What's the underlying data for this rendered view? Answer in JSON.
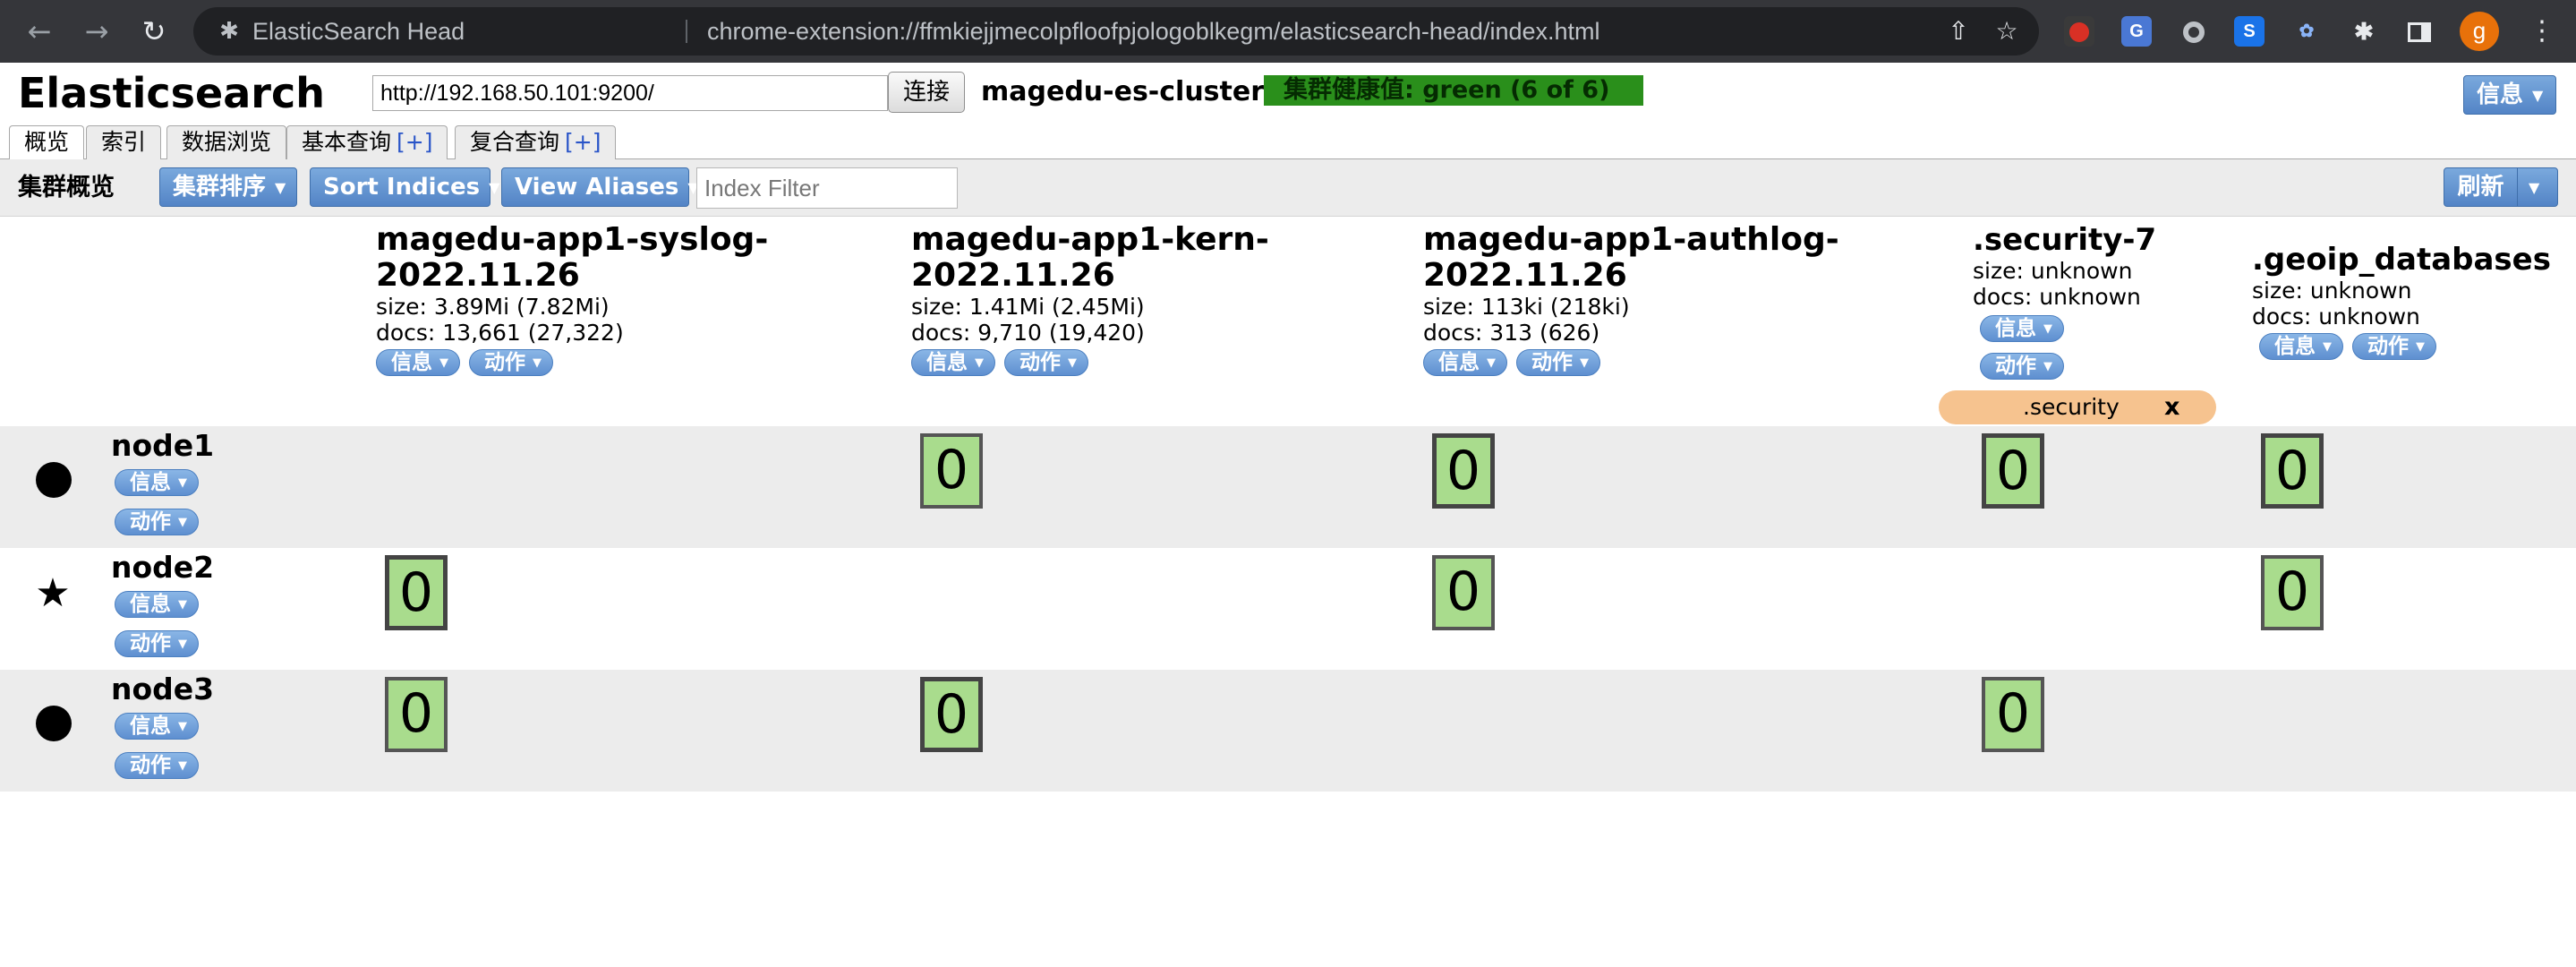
{
  "browser": {
    "site_name": "ElasticSearch Head",
    "url": "chrome-extension://ffmkiejjmecolpfloofpjologoblkegm/elasticsearch-head/index.html",
    "profile_initial": "g"
  },
  "header": {
    "title": "Elasticsearch",
    "connection_url": "http://192.168.50.101:9200/",
    "connect_label": "连接",
    "cluster_name": "magedu-es-cluster",
    "health": "集群健康值: green (6 of 6)",
    "info_label": "信息"
  },
  "tabs": [
    {
      "label": "概览",
      "plus": ""
    },
    {
      "label": "索引",
      "plus": ""
    },
    {
      "label": "数据浏览",
      "plus": ""
    },
    {
      "label": "基本查询",
      "plus": "[+]"
    },
    {
      "label": "复合查询",
      "plus": "[+]"
    }
  ],
  "toolbar": {
    "title": "集群概览",
    "sort_cluster": "集群排序",
    "sort_indices": "Sort Indices",
    "view_aliases": "View Aliases",
    "filter_placeholder": "Index Filter",
    "refresh": "刷新"
  },
  "indices": [
    {
      "name_line1": "magedu-app1-syslog-",
      "name_line2": "2022.11.26",
      "size": "size: 3.89Mi (7.82Mi)",
      "docs": "docs: 13,661 (27,322)",
      "info": "信息",
      "action": "动作"
    },
    {
      "name_line1": "magedu-app1-kern-",
      "name_line2": "2022.11.26",
      "size": "size: 1.41Mi (2.45Mi)",
      "docs": "docs: 9,710 (19,420)",
      "info": "信息",
      "action": "动作"
    },
    {
      "name_line1": "magedu-app1-authlog-",
      "name_line2": "2022.11.26",
      "size": "size: 113ki (218ki)",
      "docs": "docs: 313 (626)",
      "info": "信息",
      "action": "动作"
    },
    {
      "name_line1": ".security-7",
      "size": "size: unknown",
      "docs": "docs: unknown",
      "info": "信息",
      "action": "动作",
      "alias": ".security",
      "alias_close": "x"
    },
    {
      "name_line1": ".geoip_databases",
      "size": "size: unknown",
      "docs": "docs: unknown",
      "info": "信息",
      "action": "动作"
    }
  ],
  "nodes": [
    {
      "name": "node1",
      "marker": "circle-icon",
      "info": "信息",
      "action": "动作"
    },
    {
      "name": "node2",
      "marker": "star-icon",
      "info": "信息",
      "action": "动作"
    },
    {
      "name": "node3",
      "marker": "circle-icon",
      "info": "信息",
      "action": "动作"
    }
  ],
  "shards": {
    "node1": [
      "0",
      "0",
      "0",
      "0"
    ],
    "node2": [
      "0",
      "0",
      "0"
    ],
    "node3": [
      "0",
      "0",
      "0"
    ]
  },
  "colors": {
    "health_green": "#2a8f1b",
    "shard_fill": "#a9dc8d",
    "button_blue": "#5e8fd0",
    "alias_orange": "#f6c38f"
  }
}
